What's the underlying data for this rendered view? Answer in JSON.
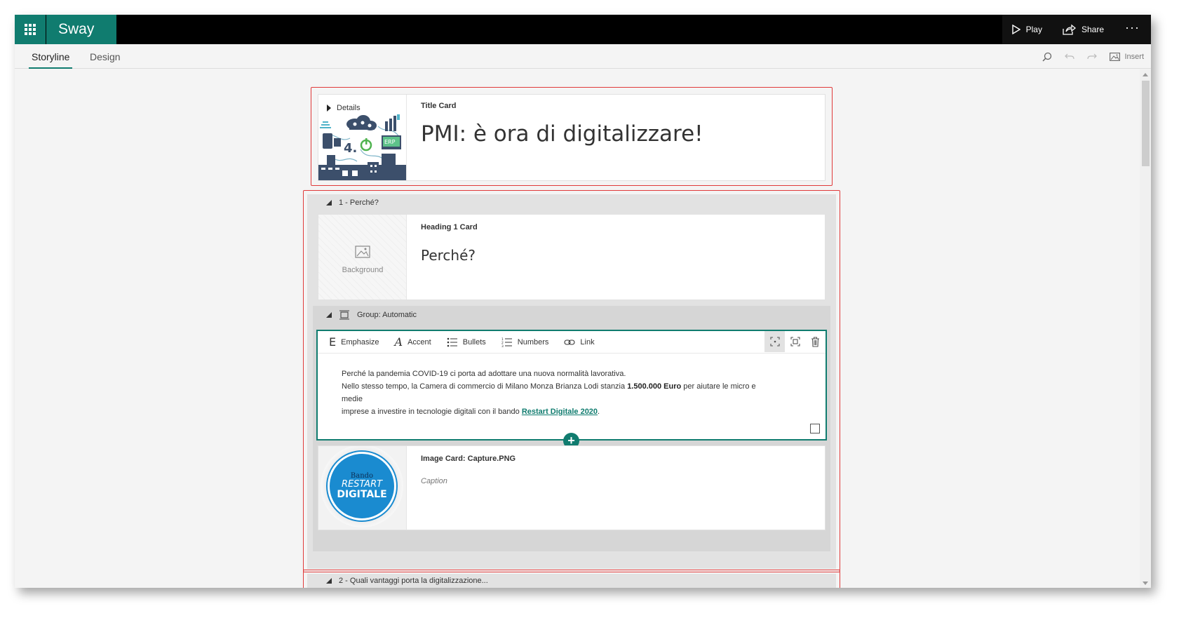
{
  "app": {
    "name": "Sway",
    "actions": {
      "play": "Play",
      "share": "Share",
      "more": "···"
    }
  },
  "tabs": [
    {
      "label": "Storyline",
      "active": true
    },
    {
      "label": "Design",
      "active": false
    }
  ],
  "toolbar": {
    "insert": "Insert"
  },
  "title_card": {
    "details": "Details",
    "type": "Title Card",
    "title": "PMI: è ora di digitalizzare!"
  },
  "section1": {
    "label": "1 - Perché?",
    "heading_card": {
      "type": "Heading 1 Card",
      "title": "Perché?",
      "background_label": "Background"
    },
    "group": {
      "label": "Group: Automatic",
      "format_bar": {
        "emphasize": "Emphasize",
        "accent": "Accent",
        "bullets": "Bullets",
        "numbers": "Numbers",
        "link": "Link"
      },
      "text": {
        "line1": "Perché la pandemia COVID-19 ci porta ad adottare una nuova normalità lavorativa.",
        "line2_pre": "Nello stesso tempo, la Camera di commercio di Milano Monza Brianza Lodi stanzia ",
        "line2_bold": "1.500.000 Euro",
        "line2_post": " per aiutare le micro e medie",
        "line3_pre": "imprese a investire in tecnologie digitali con il bando ",
        "line3_link": "Restart Digitale 2020",
        "line3_post": "."
      },
      "image_card": {
        "type": "Image Card: Capture.PNG",
        "caption": "Caption",
        "badge": {
          "line1": "Bando",
          "line2": "RESTART",
          "line3": "DIGITALE"
        }
      }
    }
  },
  "section2": {
    "label": "2 - Quali vantaggi porta la digitalizzazione..."
  },
  "colors": {
    "accent": "#107c6f",
    "outline": "#e03a3a",
    "topbar": "#000000"
  }
}
